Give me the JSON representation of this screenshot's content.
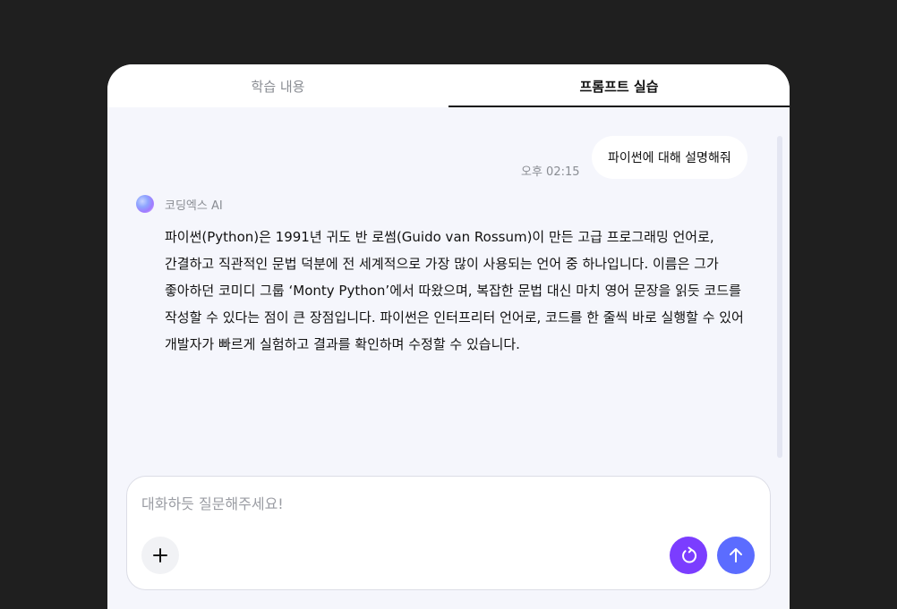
{
  "tabs": [
    {
      "label": "학습 내용",
      "active": false
    },
    {
      "label": "프롬프트 실습",
      "active": true
    }
  ],
  "chat": {
    "user_message": {
      "text": "파이썬에 대해 설명해줘",
      "time": "오후 02:15"
    },
    "ai_message": {
      "sender": "코딩엑스 AI",
      "text": "파이썬(Python)은 1991년 귀도 반 로썸(Guido van Rossum)이 만든 고급 프로그래밍 언어로, 간결하고 직관적인 문법 덕분에 전 세계적으로 가장 많이 사용되는 언어 중 하나입니다. 이름은 그가 좋아하던 코미디 그룹 ‘Monty Python’에서 따왔으며, 복잡한 문법 대신 마치 영어 문장을 읽듯 코드를 작성할 수 있다는 점이 큰 장점입니다. 파이썬은 인터프리터 언어로, 코드를 한 줄씩 바로 실행할 수 있어 개발자가 빠르게 실험하고 결과를 확인하며 수정할 수 있습니다."
    }
  },
  "composer": {
    "placeholder": "대화하듯 질문해주세요!",
    "buttons": {
      "add_icon": "plus-icon",
      "refresh_icon": "refresh-icon",
      "send_icon": "arrow-up-icon"
    }
  },
  "colors": {
    "background": "#1f1f1f",
    "panel": "#f5f6fc",
    "refresh_button": "#7b3dff",
    "send_button": "#5b6cff"
  }
}
